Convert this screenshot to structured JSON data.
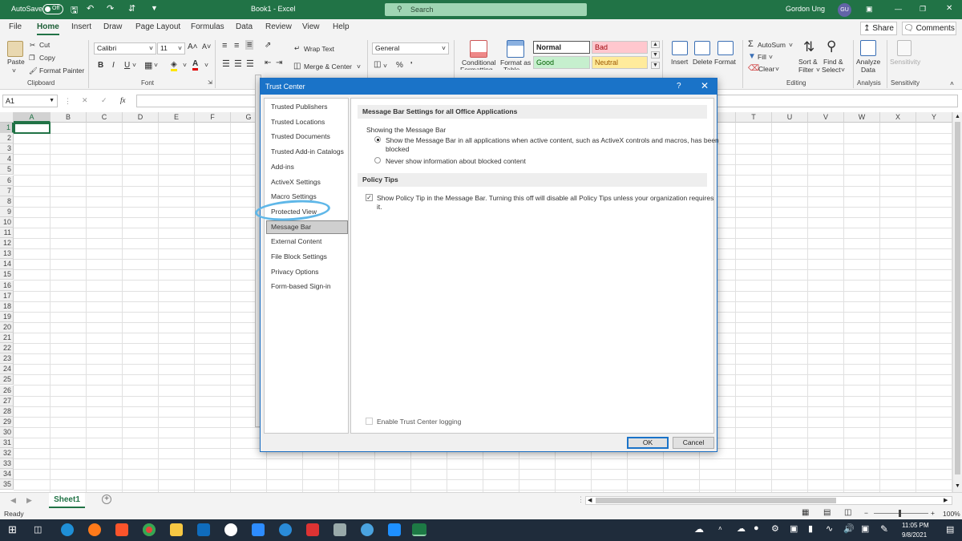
{
  "titlebar": {
    "autosave_label": "AutoSave",
    "autosave_state": "Off",
    "doc_title": "Book1 - Excel",
    "search_placeholder": "Search",
    "user_name": "Gordon Ung",
    "user_initials": "GU",
    "accent": "#217346"
  },
  "menu": {
    "items": [
      "File",
      "Home",
      "Insert",
      "Draw",
      "Page Layout",
      "Formulas",
      "Data",
      "Review",
      "View",
      "Help"
    ],
    "active": "Home",
    "share": "Share",
    "comments": "Comments"
  },
  "ribbon": {
    "clipboard": {
      "paste": "Paste",
      "cut": "Cut",
      "copy": "Copy",
      "format_painter": "Format Painter",
      "label": "Clipboard"
    },
    "font": {
      "family": "Calibri",
      "size": "11",
      "bold": "B",
      "italic": "I",
      "underline": "U",
      "grow": "A˄",
      "shrink": "A˅",
      "font_color": "A",
      "label": "Font"
    },
    "alignment": {
      "wrap_text": "Wrap Text",
      "merge_center": "Merge & Center"
    },
    "number": {
      "format": "General",
      "percent": "%",
      "comma": "'"
    },
    "styles": {
      "conditional": "Conditional",
      "conditional2": "Formatting",
      "format_as": "Format as",
      "format_as2": "Table",
      "normal": "Normal",
      "bad": "Bad",
      "good": "Good",
      "neutral": "Neutral"
    },
    "cells": {
      "insert": "Insert",
      "delete": "Delete",
      "format": "Format"
    },
    "editing": {
      "autosum": "AutoSum",
      "fill": "Fill",
      "clear": "Clear",
      "sort": "Sort &",
      "sort2": "Filter",
      "find": "Find &",
      "find2": "Select",
      "label": "Editing"
    },
    "analysis": {
      "analyze": "Analyze",
      "analyze2": "Data",
      "label": "Analysis"
    },
    "sensitivity": {
      "btn": "Sensitivity",
      "label": "Sensitivity"
    }
  },
  "formula_bar": {
    "name_box": "A1",
    "fx": "fx",
    "cancel": "✕",
    "enter": "✓"
  },
  "grid": {
    "columns": [
      "A",
      "B",
      "C",
      "D",
      "E",
      "F",
      "G",
      "",
      "",
      "",
      "",
      "",
      "",
      "",
      "",
      "",
      "",
      "",
      "",
      "",
      "T",
      "U",
      "V",
      "W",
      "X",
      "Y",
      "Z"
    ],
    "rows": [
      "1",
      "2",
      "3",
      "4",
      "5",
      "6",
      "7",
      "8",
      "9",
      "10",
      "11",
      "12",
      "13",
      "14",
      "15",
      "16",
      "17",
      "18",
      "19",
      "20",
      "21",
      "22",
      "23",
      "24",
      "25",
      "26",
      "27",
      "28",
      "29",
      "30",
      "31",
      "32",
      "33",
      "34",
      "35"
    ],
    "selected_cell": "A1"
  },
  "sheets": {
    "active": "Sheet1",
    "add": "+"
  },
  "status": {
    "ready": "Ready",
    "zoom": "100%",
    "zoom_minus": "−",
    "zoom_plus": "+"
  },
  "taskbar": {
    "time": "11:05 PM",
    "date": "9/8/2021"
  },
  "dialog": {
    "title": "Trust Center",
    "help": "?",
    "close": "✕",
    "nav": [
      "Trusted Publishers",
      "Trusted Locations",
      "Trusted Documents",
      "Trusted Add-in Catalogs",
      "Add-ins",
      "ActiveX Settings",
      "Macro Settings",
      "Protected View",
      "Message Bar",
      "External Content",
      "File Block Settings",
      "Privacy Options",
      "Form-based Sign-in"
    ],
    "selected_nav": "Message Bar",
    "section1": "Message Bar Settings for all Office Applications",
    "showing": "Showing the Message Bar",
    "radio1_line1": "Show the Message Bar in all applications when active content, such as ActiveX controls and macros, has been",
    "radio1_line2": "blocked",
    "radio2": "Never show information about blocked content",
    "section2": "Policy Tips",
    "policy_line1": "Show Policy Tip in the Message Bar. Turning this off will disable all Policy Tips unless your organization requires",
    "policy_line2": "it.",
    "logging": "Enable Trust Center logging",
    "ok": "OK",
    "cancel": "Cancel"
  }
}
